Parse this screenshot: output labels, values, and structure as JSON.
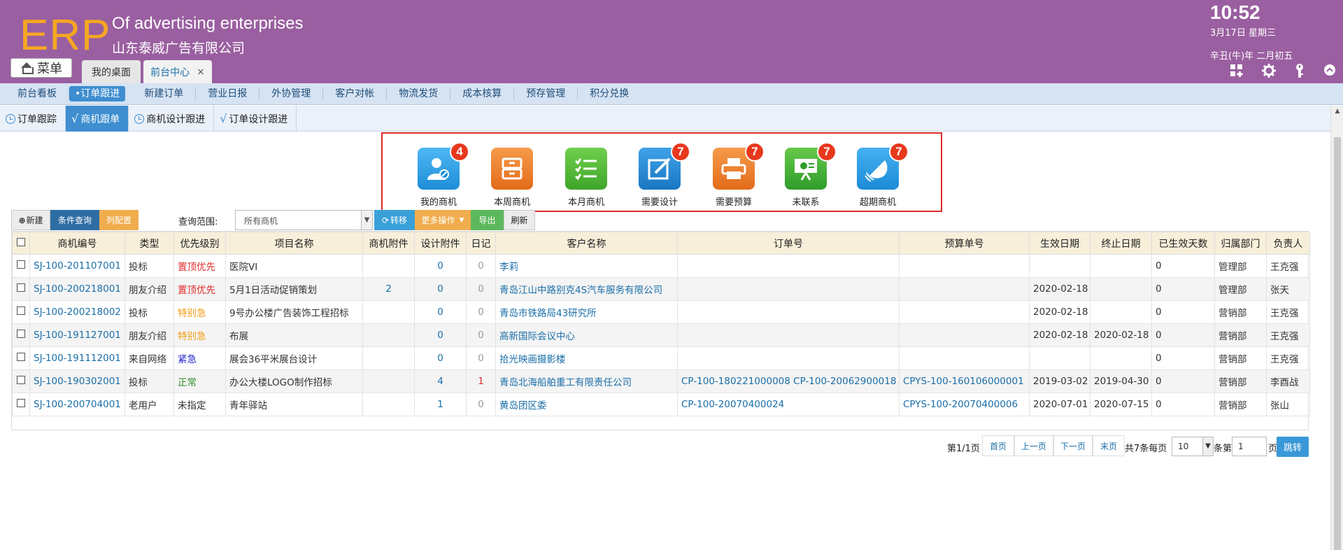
{
  "header": {
    "logo": "ERP",
    "company_en": "Of advertising enterprises",
    "company_cn": "山东泰威广告有限公司",
    "time": "10:52",
    "date": "3月17日 星期三",
    "lunar": "辛丑(牛)年 二月初五",
    "menu_label": "菜单",
    "window_tabs": [
      {
        "label": "我的桌面"
      },
      {
        "label": "前台中心",
        "close": "×"
      }
    ],
    "icons": [
      "grid-icon",
      "gear-icon",
      "key-icon",
      "collapse-icon"
    ]
  },
  "main_nav": [
    "前台看板",
    "•订单跟进",
    "新建订单",
    "营业日报",
    "外协管理",
    "客户对帐",
    "物流发货",
    "成本核算",
    "预存管理",
    "积分兑换"
  ],
  "main_nav_active": 1,
  "sub_tabs": [
    {
      "label": "订单跟踪",
      "icon": "clock-icon"
    },
    {
      "label": "商机跟单",
      "icon": "check-icon",
      "active": true
    },
    {
      "label": "商机设计跟进",
      "icon": "clock-icon"
    },
    {
      "label": "订单设计跟进",
      "icon": "check-icon"
    }
  ],
  "quick": [
    {
      "label": "我的商机",
      "badge": "4",
      "icon": "person-icon",
      "color": "#2a9be3"
    },
    {
      "label": "本周商机",
      "badge": "",
      "icon": "drawer-icon",
      "color": "#ed7f31"
    },
    {
      "label": "本月商机",
      "badge": "",
      "icon": "checklist-icon",
      "color": "#4bb93a"
    },
    {
      "label": "需要设计",
      "badge": "7",
      "icon": "edit-icon",
      "color": "#238ad6"
    },
    {
      "label": "需要预算",
      "badge": "7",
      "icon": "printer-icon",
      "color": "#ed7f31"
    },
    {
      "label": "未联系",
      "badge": "7",
      "icon": "presentation-icon",
      "color": "#3fae34"
    },
    {
      "label": "超期商机",
      "badge": "7",
      "icon": "bell-icon",
      "color": "#2a9be3"
    }
  ],
  "toolbar": {
    "new": "新建",
    "query": "条件查询",
    "columns": "列配置",
    "range_label": "查询范围:",
    "range_value": "所有商机",
    "move": "转移",
    "more": "更多操作",
    "export": "导出",
    "refresh": "刷新"
  },
  "table": {
    "headers": [
      "商机编号",
      "类型",
      "优先级别",
      "项目名称",
      "商机附件",
      "设计附件",
      "日记",
      "客户名称",
      "订单号",
      "预算单号",
      "生效日期",
      "终止日期",
      "已生效天数",
      "归属部门",
      "负责人"
    ],
    "rows": [
      [
        "SJ-100-201107001",
        "投标",
        "置顶优先",
        "医院VI",
        "",
        "0",
        "0",
        "李莉",
        "",
        "",
        "",
        "",
        "0",
        "管理部",
        "王克强"
      ],
      [
        "SJ-100-200218001",
        "朋友介绍",
        "置顶优先",
        "5月1日活动促销策划",
        "2",
        "0",
        "0",
        "青岛江山中路别克4S汽车服务有限公司",
        "",
        "",
        "2020-02-18",
        "",
        "0",
        "管理部",
        "张天"
      ],
      [
        "SJ-100-200218002",
        "投标",
        "特别急",
        "9号办公楼广告装饰工程招标",
        "",
        "0",
        "0",
        "青岛市铁路局43研究所",
        "",
        "",
        "2020-02-18",
        "",
        "0",
        "营销部",
        "王克强"
      ],
      [
        "SJ-100-191127001",
        "朋友介绍",
        "特别急",
        "布展",
        "",
        "0",
        "0",
        "高新国际会议中心",
        "",
        "",
        "2020-02-18",
        "2020-02-18",
        "0",
        "营销部",
        "王克强"
      ],
      [
        "SJ-100-191112001",
        "来自网络",
        "紧急",
        "展会36平米展台设计",
        "",
        "0",
        "0",
        "拾光映画摄影楼",
        "",
        "",
        "",
        "",
        "0",
        "营销部",
        "王克强"
      ],
      [
        "SJ-100-190302001",
        "投标",
        "正常",
        "办公大楼LOGO制作招标",
        "",
        "4",
        "1",
        "青岛北海船舶重工有限责任公司",
        "CP-100-180221000008 CP-100-20062900018",
        "CPYS-100-160106000001",
        "2019-03-02",
        "2019-04-30",
        "0",
        "营销部",
        "李酉战"
      ],
      [
        "SJ-100-200704001",
        "老用户",
        "未指定",
        "青年驿站",
        "",
        "1",
        "0",
        "黄岛团区委",
        "CP-100-20070400024",
        "CPYS-100-20070400006",
        "2020-07-01",
        "2020-07-15",
        "0",
        "营销部",
        "张山"
      ]
    ]
  },
  "pager": {
    "page_info": "第1/1页",
    "first": "首页",
    "prev": "上一页",
    "next": "下一页",
    "last": "末页",
    "total": "共7条每页",
    "page_size": "10",
    "goto_prefix": "条第",
    "goto_value": "1",
    "goto_suffix": "页",
    "go": "跳转"
  }
}
